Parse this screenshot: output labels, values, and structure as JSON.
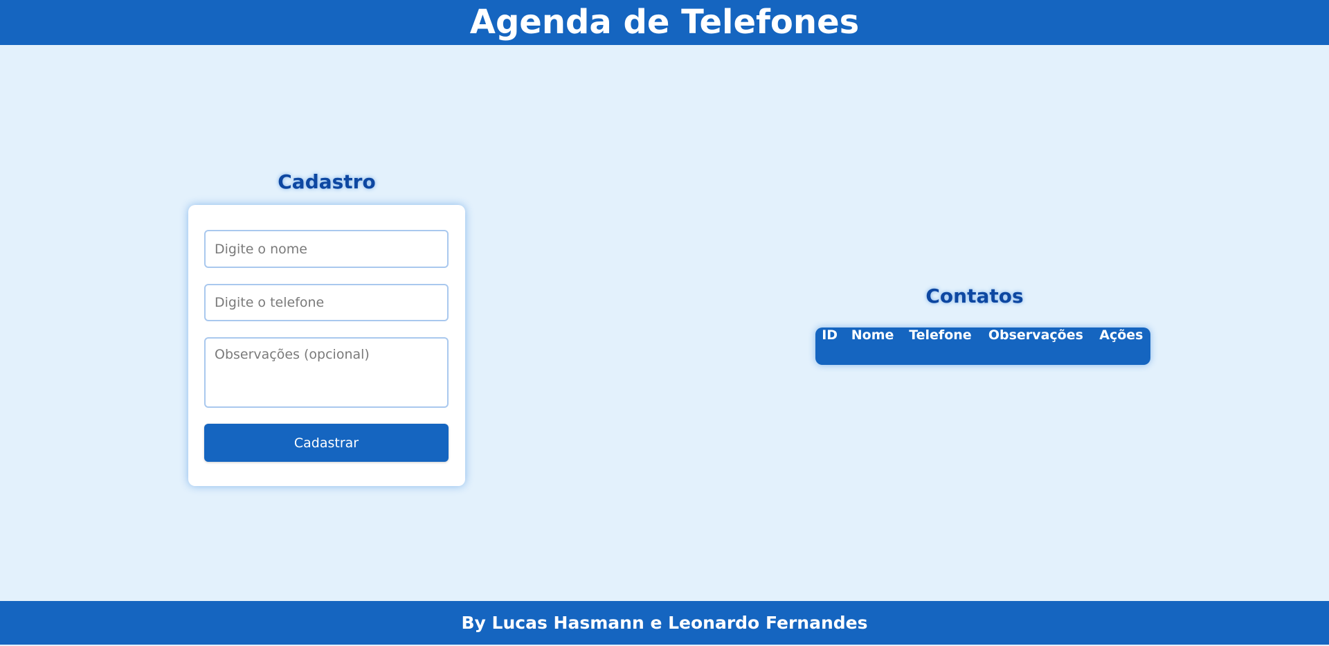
{
  "header": {
    "title": "Agenda de Telefones"
  },
  "cadastro": {
    "title": "Cadastro",
    "nome_placeholder": "Digite o nome",
    "telefone_placeholder": "Digite o telefone",
    "observacoes_placeholder": "Observações (opcional)",
    "submit_label": "Cadastrar"
  },
  "contatos": {
    "title": "Contatos",
    "columns": [
      "ID",
      "Nome",
      "Telefone",
      "Observações",
      "Ações"
    ]
  },
  "footer": {
    "text": "By Lucas Hasmann e Leonardo Fernandes"
  },
  "colors": {
    "primary": "#1565c0",
    "background": "#e3f1fc",
    "title_text": "#0d47a1"
  }
}
